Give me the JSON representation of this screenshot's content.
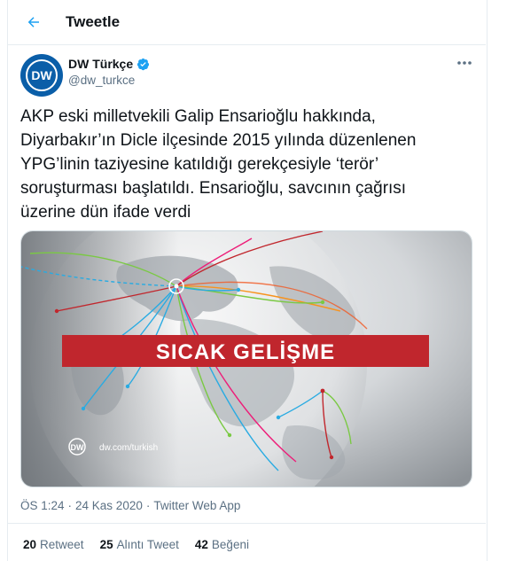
{
  "header": {
    "title": "Tweetle",
    "back_icon": "arrow-left-icon"
  },
  "author": {
    "name": "DW Türkçe",
    "handle": "@dw_turkce",
    "avatar_text": "DW",
    "verified_icon": "verified-badge-icon",
    "more_icon": "more-horizontal-icon"
  },
  "tweet": {
    "text": "AKP eski milletvekili Galip Ensarioğlu hakkında,\nDiyarbakır’ın Dicle ilçesinde 2015 yılında düzenlenen\nYPG’linin taziyesine katıldığı gerekçesiyle ‘terör’\nsoruşturması başlatıldı. Ensarioğlu, savcının çağrısı\nüzerine dün ifade verdi"
  },
  "media": {
    "banner": "SICAK GELİŞME",
    "logo_text": "DW",
    "site": "dw.com/turkish"
  },
  "meta": {
    "time": "ÖS 1:24",
    "sep": "·",
    "date": "24 Kas 2020",
    "source": "Twitter Web App"
  },
  "stats": {
    "retweets": "20",
    "retweets_label": "Retweet",
    "quotes": "25",
    "quotes_label": "Alıntı Tweet",
    "likes": "42",
    "likes_label": "Beğeni"
  },
  "colors": {
    "accent": "#1da1f2",
    "banner_red": "#c0262d",
    "dw_blue": "#0a5ea8"
  }
}
